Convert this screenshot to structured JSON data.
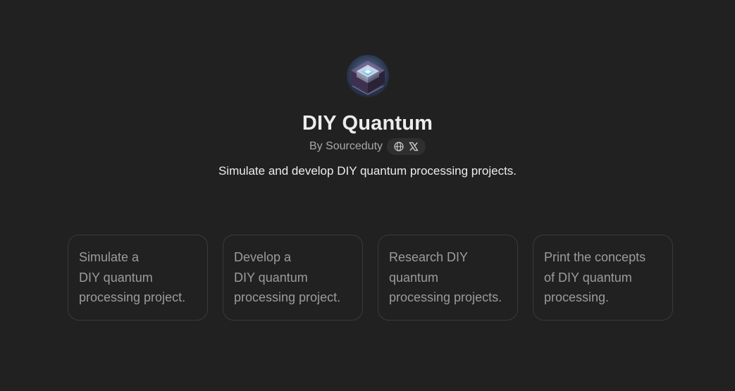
{
  "gpt": {
    "title": "DIY Quantum",
    "byline": "By Sourceduty",
    "description": "Simulate and develop DIY quantum processing projects.",
    "social_icons": [
      "globe-icon",
      "x-logo-icon"
    ]
  },
  "starters": [
    {
      "lines": [
        "Simulate a",
        "DIY quantum",
        "processing project."
      ]
    },
    {
      "lines": [
        "Develop a",
        "DIY quantum",
        "processing project."
      ]
    },
    {
      "lines": [
        "Research DIY",
        "quantum",
        "processing projects."
      ]
    },
    {
      "lines": [
        "Print the concepts",
        "of DIY quantum",
        "processing."
      ]
    }
  ],
  "colors": {
    "background": "#212121",
    "title": "#ececec",
    "muted": "#a8a8a8",
    "card_border": "#3a3a3a",
    "card_text": "#9b9b9b"
  }
}
